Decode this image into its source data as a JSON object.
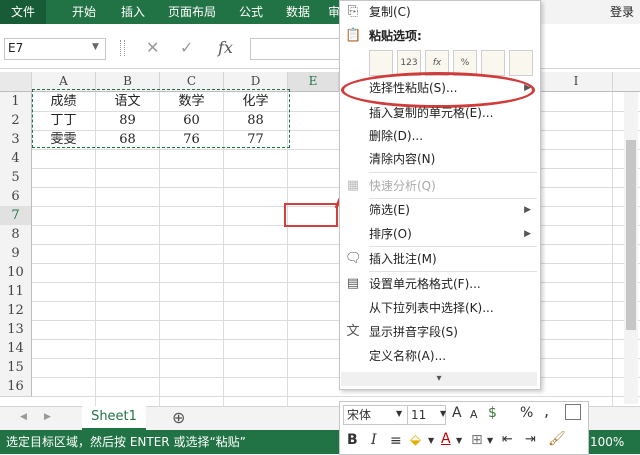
{
  "ribbon": {
    "tabs": [
      "文件",
      "开始",
      "插入",
      "页面布局",
      "公式",
      "数据",
      "审"
    ],
    "login": "登录"
  },
  "formula_bar": {
    "name_box": "E7",
    "fx": "fx"
  },
  "sheet": {
    "columns": [
      "A",
      "B",
      "C",
      "D",
      "E",
      "I"
    ],
    "rows": [
      "1",
      "2",
      "3",
      "4",
      "5",
      "6",
      "7",
      "8",
      "9",
      "10",
      "11",
      "12",
      "13",
      "14",
      "15",
      "16"
    ],
    "cells": {
      "row1": [
        "成绩",
        "语文",
        "数学",
        "化学"
      ],
      "row2": [
        "丁丁",
        "89",
        "60",
        "88"
      ],
      "row3": [
        "雯雯",
        "68",
        "76",
        "77"
      ]
    },
    "tab_name": "Sheet1",
    "add_sheet": "⊕"
  },
  "status": {
    "message": "选定目标区域，然后按 ENTER 或选择“粘贴”",
    "zoom": "100%"
  },
  "context_menu": {
    "copy": "复制(C)",
    "paste_options": "粘贴选项:",
    "paste_icon_labels": [
      "",
      "123",
      "fx",
      "%",
      "",
      ""
    ],
    "paste_special": "选择性粘贴(S)...",
    "insert_copied": "插入复制的单元格(E)...",
    "delete": "删除(D)...",
    "clear": "清除内容(N)",
    "quick_analysis": "快速分析(Q)",
    "filter": "筛选(E)",
    "sort": "排序(O)",
    "insert_comment": "插入批注(M)",
    "format_cells": "设置单元格格式(F)...",
    "pick_list": "从下拉列表中选择(K)...",
    "phonetic": "显示拼音字段(S)",
    "define_name": "定义名称(A)...",
    "more": "▾"
  },
  "mini_toolbar": {
    "font": "宋体",
    "size": "11",
    "bold": "B",
    "italic": "I",
    "grow": "A",
    "shrink": "A",
    "currency": "$",
    "percent": "%",
    "comma": ","
  },
  "colors": {
    "excel_green": "#217346",
    "annotation_red": "#d03c3c"
  }
}
